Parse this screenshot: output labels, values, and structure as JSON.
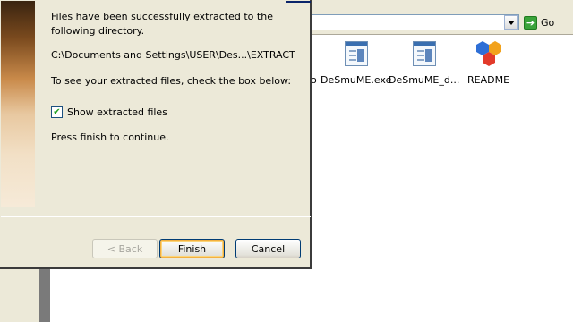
{
  "explorer": {
    "address_value": "",
    "go_label": "Go",
    "files": [
      {
        "name": "DeSmuME.exe",
        "icon": "exe-icon"
      },
      {
        "name": "DeSmuME_d...",
        "icon": "exe-icon"
      },
      {
        "name": "README",
        "icon": "readme-icon"
      }
    ],
    "partial_label": "o"
  },
  "wizard": {
    "message_success": "Files have been successfully extracted to the following directory.",
    "path": "C:\\Documents and Settings\\USER\\Des...\\EXTRACT",
    "message_check": "To see your extracted files, check the box below:",
    "checkbox_label": "Show extracted files",
    "checkbox_checked": true,
    "message_finish": "Press finish to continue.",
    "back_label": "< Back",
    "finish_label": "Finish",
    "cancel_label": "Cancel"
  },
  "colors": {
    "dialog_face": "#ece9d8",
    "title_blue": "#0a246a",
    "go_green": "#3aa33a"
  }
}
